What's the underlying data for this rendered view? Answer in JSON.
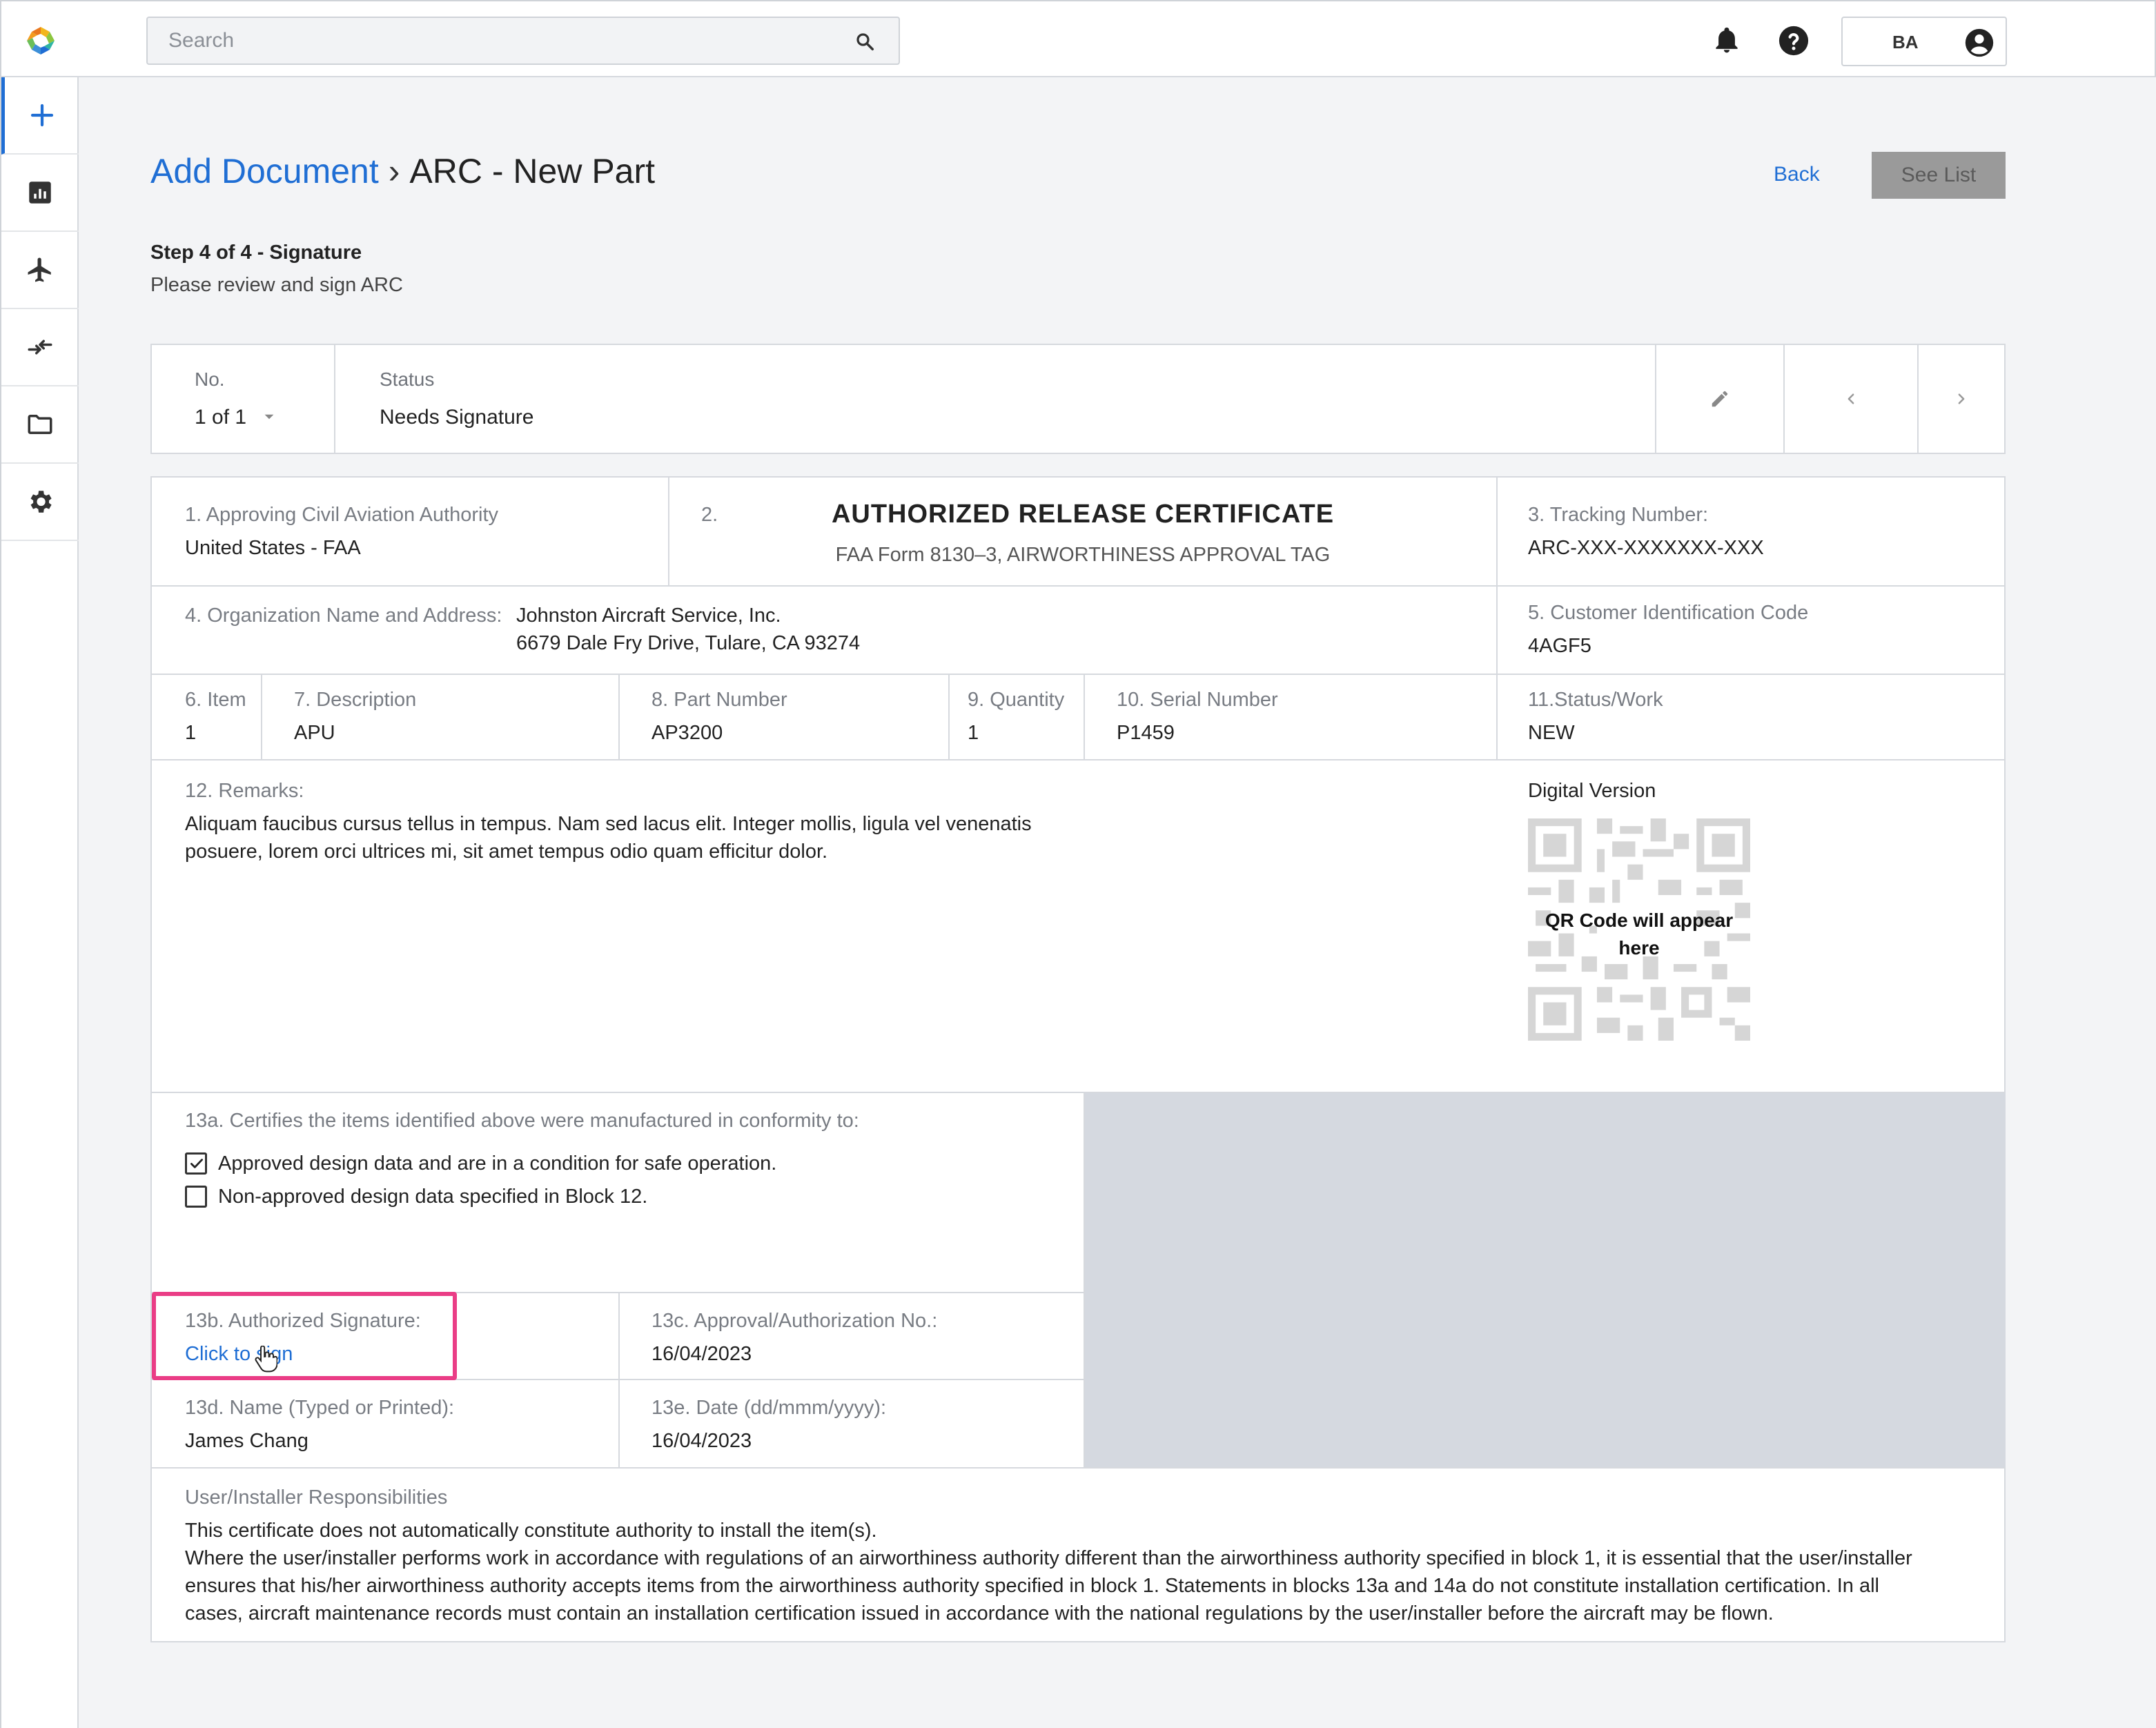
{
  "topbar": {
    "search_placeholder": "Search",
    "user_initials": "BA"
  },
  "sidebar": {
    "items": [
      {
        "icon": "plus-icon"
      },
      {
        "icon": "chart-icon"
      },
      {
        "icon": "airplane-icon"
      },
      {
        "icon": "transfer-icon"
      },
      {
        "icon": "folder-icon"
      },
      {
        "icon": "gear-icon"
      }
    ]
  },
  "header": {
    "breadcrumb_link": "Add Document",
    "breadcrumb_sep": "›",
    "breadcrumb_current": "ARC - New Part",
    "back_label": "Back",
    "see_list_label": "See List",
    "step_title": "Step 4 of 4 - Signature",
    "step_subtitle": "Please review and sign ARC"
  },
  "navbar": {
    "no_label": "No.",
    "no_value": "1 of 1",
    "status_label": "Status",
    "status_value": "Needs Signature"
  },
  "form": {
    "f1_label": "1. Approving Civil Aviation Authority",
    "f1_value": "United States - FAA",
    "f2_label": "2.",
    "title": "AUTHORIZED RELEASE CERTIFICATE",
    "subtitle": "FAA Form 8130–3, AIRWORTHINESS APPROVAL TAG",
    "f3_label": "3. Tracking Number:",
    "f3_value": "ARC-XXX-XXXXXXX-XXX",
    "f4_label": "4. Organization Name and Address:",
    "f4_line1": "Johnston Aircraft Service, Inc.",
    "f4_line2": "6679 Dale Fry Drive, Tulare, CA 93274",
    "f5_label": "5. Customer Identification Code",
    "f5_value": "4AGF5",
    "f6_label": "6. Item",
    "f6_value": "1",
    "f7_label": "7. Description",
    "f7_value": "APU",
    "f8_label": "8. Part Number",
    "f8_value": "AP3200",
    "f9_label": "9. Quantity",
    "f9_value": "1",
    "f10_label": "10. Serial Number",
    "f10_value": "P1459",
    "f11_label": "11.Status/Work",
    "f11_value": "NEW",
    "f12_label": "12. Remarks:",
    "f12_line1": "Aliquam faucibus cursus tellus in tempus. Nam sed lacus elit. Integer mollis, ligula vel venenatis",
    "f12_line2": "posuere, lorem orci ultrices mi, sit amet tempus odio quam efficitur dolor.",
    "digital_label": "Digital Version",
    "qr_line1": "QR Code will appear",
    "qr_line2": "here",
    "f13a_label": "13a. Certifies the items identified above were manufactured in conformity to:",
    "f13a_opt1": "Approved design data and are in a condition for safe operation.",
    "f13a_opt1_checked": true,
    "f13a_opt2": "Non-approved design data specified in Block 12.",
    "f13a_opt2_checked": false,
    "f13b_label": "13b. Authorized Signature:",
    "f13b_link": "Click to sign",
    "f13c_label": "13c. Approval/Authorization No.:",
    "f13c_value": "16/04/2023",
    "f13d_label": "13d. Name (Typed or Printed):",
    "f13d_value": "James Chang",
    "f13e_label": "13e. Date (dd/mmm/yyyy):",
    "f13e_value": "16/04/2023",
    "resp_label": "User/Installer Responsibilities",
    "resp_line1": "This certificate does not automatically constitute authority to install the item(s).",
    "resp_line2": "Where the user/installer performs work in accordance with regulations of an airworthiness authority different than the airworthiness authority specified in block 1, it is essential that the user/installer",
    "resp_line3": "ensures that his/her airworthiness authority accepts items from the airworthiness authority specified in block 1. Statements in blocks 13a and 14a do not constitute installation certification. In all",
    "resp_line4": "cases, aircraft maintenance records must contain an installation certification issued in accordance with the national regulations by the user/installer before the aircraft may be flown."
  },
  "colors": {
    "accent": "#1f6ed4",
    "highlight": "#ea3d86",
    "disabled_button": "#9a9a9a",
    "grey_block": "#d5d9e0"
  }
}
